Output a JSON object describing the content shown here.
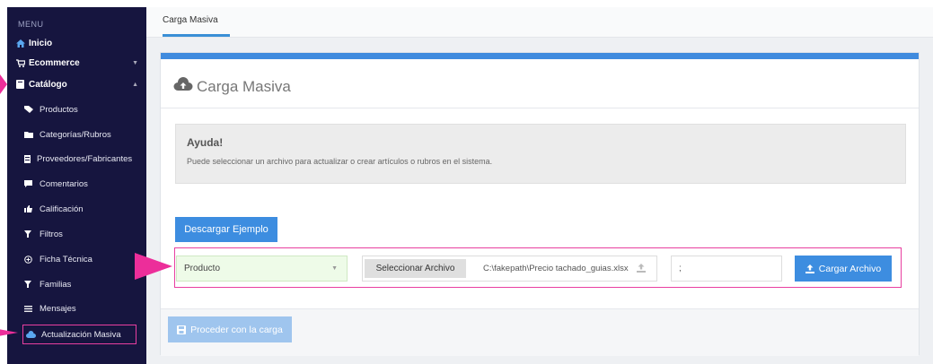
{
  "sidebar": {
    "menu_label": "MENU",
    "top_items": [
      {
        "label": "Inicio",
        "icon": "home-icon"
      },
      {
        "label": "Ecommerce",
        "icon": "cart-icon"
      },
      {
        "label": "Catálogo",
        "icon": "book-icon"
      }
    ],
    "sub_items": [
      {
        "label": "Productos",
        "icon": "tag-icon"
      },
      {
        "label": "Categorías/Rubros",
        "icon": "folder-icon"
      },
      {
        "label": "Proveedores/Fabricantes",
        "icon": "list-icon"
      },
      {
        "label": "Comentarios",
        "icon": "comment-icon"
      },
      {
        "label": "Calificación",
        "icon": "thumbs-up-icon"
      },
      {
        "label": "Filtros",
        "icon": "filter-icon"
      },
      {
        "label": "Ficha Técnica",
        "icon": "circle-plus-icon"
      },
      {
        "label": "Familias",
        "icon": "filter-icon"
      },
      {
        "label": "Mensajes",
        "icon": "lines-icon"
      },
      {
        "label": "Actualización Masiva",
        "icon": "cloud-upload-icon"
      }
    ]
  },
  "topbar": {
    "tab_label": "Carga Masiva"
  },
  "panel": {
    "title": "Carga Masiva",
    "help_title": "Ayuda!",
    "help_text": "Puede seleccionar un archivo para actualizar o crear artículos o rubros en el sistema.",
    "download_button": "Descargar Ejemplo",
    "type_select_value": "Producto",
    "select_file_button": "Seleccionar Archivo",
    "file_path": "C:\\fakepath\\Precio tachado_guias.xlsx",
    "separator_value": ";",
    "upload_button": "Cargar Archivo",
    "proceed_button": "Proceder con la carga"
  },
  "colors": {
    "sidebar_bg": "#16153f",
    "accent": "#3d8de0",
    "highlight": "#e83fa0"
  }
}
